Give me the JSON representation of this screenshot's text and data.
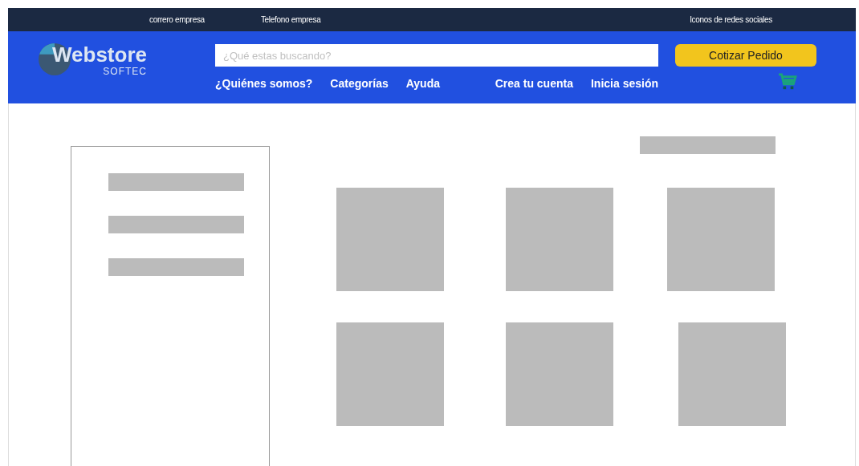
{
  "top_bar": {
    "email": "correro empresa",
    "phone": "Telefono empresa",
    "social": "Iconos de redes sociales"
  },
  "logo": {
    "name": "Webstore",
    "tagline": "SOFTEC"
  },
  "search": {
    "placeholder": "¿Qué estas buscando?"
  },
  "quote_button": "Cotizar Pedido",
  "nav": [
    "¿Quiénes somos?",
    "Categorías",
    "Ayuda"
  ],
  "account": [
    "Crea tu cuenta",
    "Inicia sesión"
  ],
  "sidebar": {
    "items": [
      {
        "kind": "placeholder"
      },
      {
        "kind": "placeholder"
      },
      {
        "kind": "placeholder"
      }
    ]
  },
  "sort_bar": {
    "kind": "placeholder"
  },
  "products": [
    {
      "kind": "placeholder"
    },
    {
      "kind": "placeholder"
    },
    {
      "kind": "placeholder"
    },
    {
      "kind": "placeholder"
    },
    {
      "kind": "placeholder"
    },
    {
      "kind": "placeholder"
    }
  ]
}
